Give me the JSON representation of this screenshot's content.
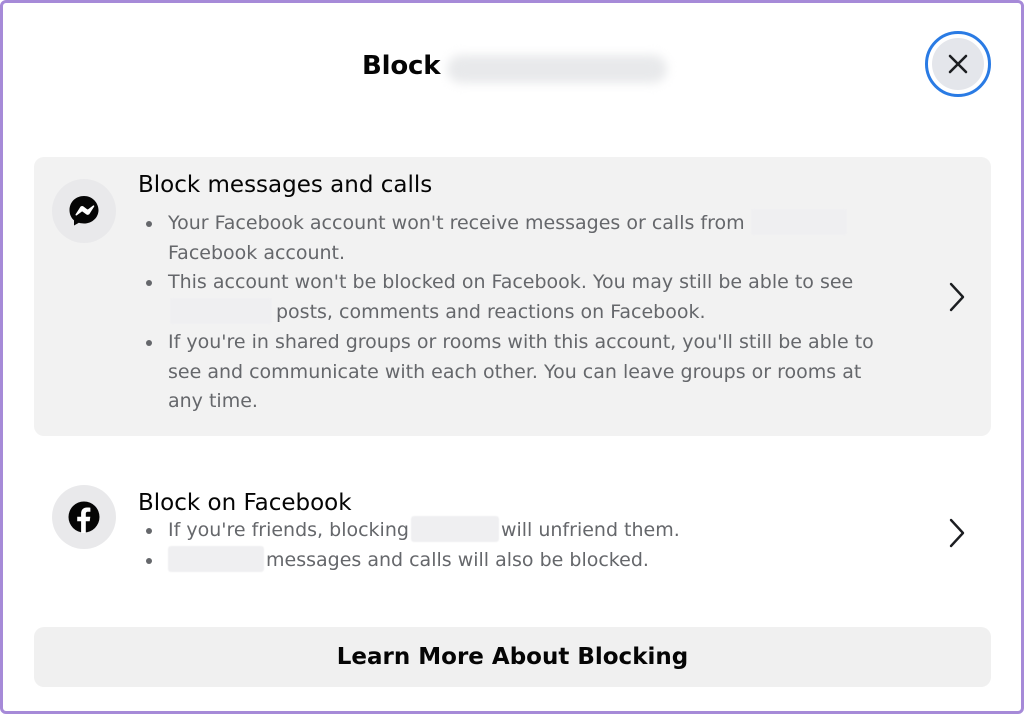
{
  "dialog": {
    "title": "Block",
    "close_label": "Close",
    "accent_color": "#2a7be4"
  },
  "options": [
    {
      "icon": "messenger-icon",
      "title": "Block messages and calls",
      "bullets": [
        {
          "pre": "Your Facebook account won't receive messages or calls from",
          "post": "Facebook account."
        },
        {
          "pre": "This account won't be blocked on Facebook. You may still be able to see",
          "post": "posts, comments and reactions on Facebook."
        },
        {
          "pre": "If you're in shared groups or rooms with this account, you'll still be able to see and communicate with each other. You can leave groups or rooms at any time.",
          "post": ""
        }
      ]
    },
    {
      "icon": "facebook-icon",
      "title": "Block on Facebook",
      "bullets": [
        {
          "pre": "If you're friends, blocking",
          "post": "will unfriend them."
        },
        {
          "pre": "",
          "post": "messages and calls will also be blocked."
        }
      ]
    }
  ],
  "learn_more_label": "Learn More About Blocking"
}
